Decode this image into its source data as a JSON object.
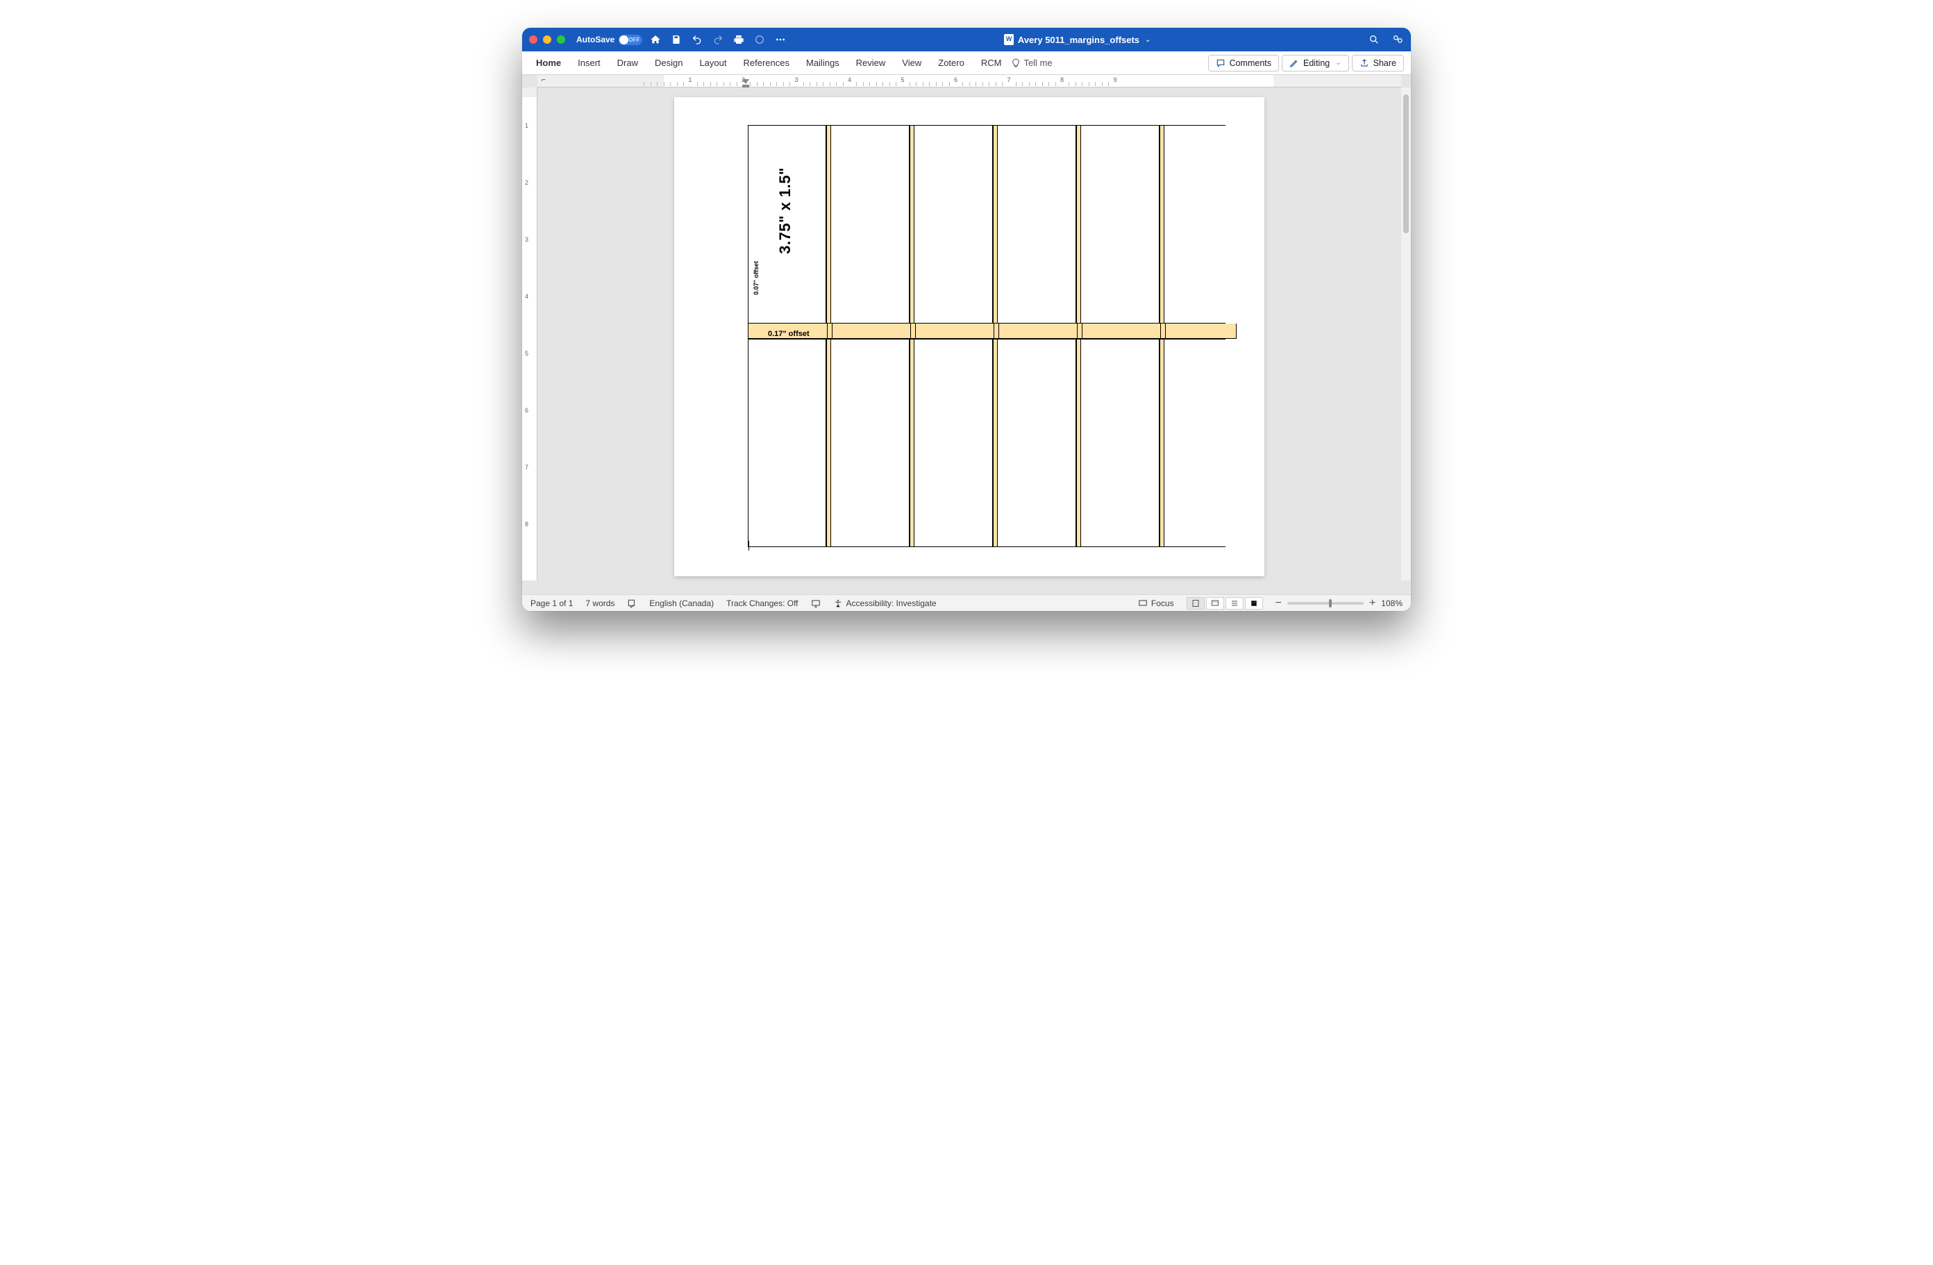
{
  "titlebar": {
    "autosave_label": "AutoSave",
    "autosave_state": "OFF",
    "document_title": "Avery 5011_margins_offsets"
  },
  "ribbon": {
    "tabs": [
      "Home",
      "Insert",
      "Draw",
      "Design",
      "Layout",
      "References",
      "Mailings",
      "Review",
      "View",
      "Zotero",
      "RCM"
    ],
    "tell_me": "Tell me",
    "comments": "Comments",
    "editing": "Editing",
    "share": "Share"
  },
  "ruler": {
    "h_numbers": [
      "1",
      "2",
      "3",
      "4",
      "5",
      "6",
      "7",
      "8",
      "9"
    ],
    "v_numbers": [
      "1",
      "2",
      "3",
      "4",
      "5",
      "6",
      "7",
      "8"
    ]
  },
  "document": {
    "label_size_text": "3.75\" x 1.5\"",
    "v_offset_text": "0.07\" offset",
    "h_offset_text": "0.17\" offset"
  },
  "statusbar": {
    "page": "Page 1 of 1",
    "words": "7 words",
    "language": "English (Canada)",
    "track": "Track Changes: Off",
    "accessibility": "Accessibility: Investigate",
    "focus": "Focus",
    "zoom": "108%",
    "zoom_pos_pct": 55
  }
}
